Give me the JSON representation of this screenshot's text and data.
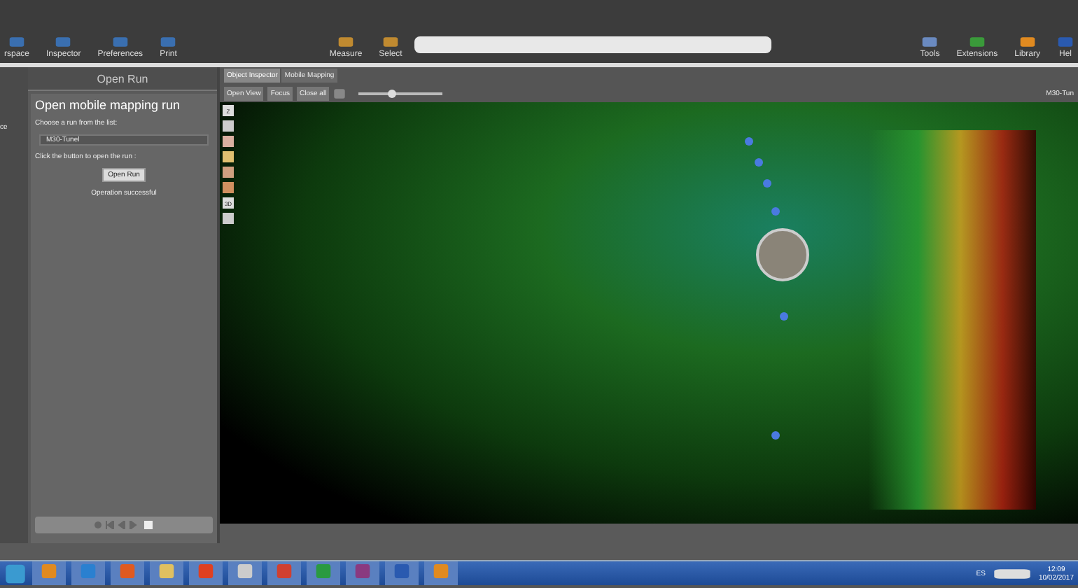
{
  "toolbar": {
    "left_items": [
      "rspace",
      "Inspector",
      "Preferences",
      "Print"
    ],
    "right_items": [
      "Measure",
      "Select"
    ],
    "far_right_items": [
      "Tools",
      "Extensions",
      "Library",
      "Hel"
    ]
  },
  "side_strip": {
    "label": "ce"
  },
  "panel": {
    "header": "Open Run",
    "title": "Open mobile mapping run",
    "choose_label": "Choose a run from the list:",
    "dropdown": {
      "value": "M30-Tunel"
    },
    "click_label": "Click the button to open the run :",
    "open_button": "Open Run",
    "status": "Operation successful"
  },
  "tabs": [
    {
      "label": "Object Inspector",
      "selected": true
    },
    {
      "label": "Mobile Mapping",
      "selected": false
    }
  ],
  "view_toolbar": {
    "buttons": [
      "Open View",
      "Focus",
      "Close all"
    ],
    "zoom_slider": {
      "level": 0.4
    },
    "run_name": "M30-Tun"
  },
  "viewport_tools": [
    "Z",
    "3D"
  ],
  "taskbar": {
    "language": "ES",
    "time": "12:09",
    "date": "10/02/2017"
  }
}
